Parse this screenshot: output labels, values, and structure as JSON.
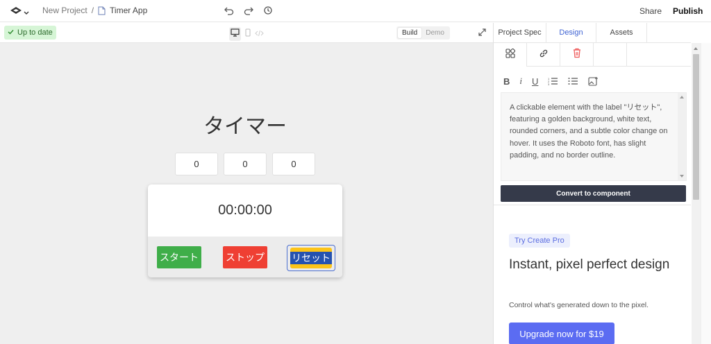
{
  "header": {
    "project": "New Project",
    "separator": "/",
    "file": "Timer App",
    "share": "Share",
    "publish": "Publish"
  },
  "toolbar": {
    "status": "Up to date",
    "mode_build": "Build",
    "mode_demo": "Demo"
  },
  "timer": {
    "title": "タイマー",
    "inputs": [
      "0",
      "0",
      "0"
    ],
    "display": "00:00:00",
    "start": "スタート",
    "stop": "ストップ",
    "reset": "リセット"
  },
  "panel": {
    "tabs": [
      "Project Spec",
      "Design",
      "Assets"
    ],
    "active_tab": "Design",
    "format_bold": "B",
    "format_italic": "i",
    "format_underline": "U",
    "description": "A clickable element with the label \"リセット\", featuring a golden background, white text, rounded corners, and a subtle color change on hover. It uses the Roboto font, has slight padding, and no border outline.",
    "convert_button": "Convert to component",
    "promo_badge": "Try Create Pro",
    "promo_title": "Instant, pixel perfect design",
    "promo_subtitle": "Control what's generated down to the pixel.",
    "upgrade_button": "Upgrade now for $19"
  },
  "colors": {
    "start": "#3fae49",
    "stop": "#ef3f33",
    "reset": "#fcc419",
    "accent": "#3f63d3",
    "upgrade": "#5b6cf2",
    "convert": "#353a4a"
  }
}
